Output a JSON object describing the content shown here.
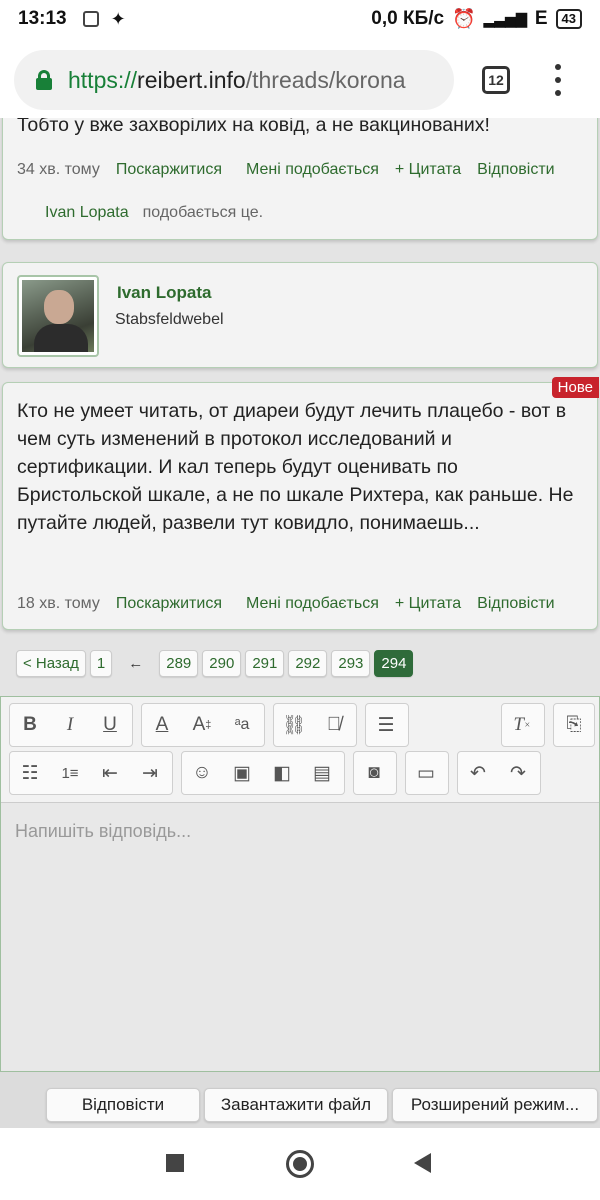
{
  "statusbar": {
    "time": "13:13",
    "net_speed": "0,0 КБ/с",
    "network_type": "E",
    "battery": "43"
  },
  "browser": {
    "url_scheme": "https://",
    "url_host": "reibert.info",
    "url_path": "/threads/korona",
    "tab_count": "12"
  },
  "post1": {
    "text": "Тобто у вже захворілих на ковід, а не вакцинованих!",
    "time_ago": "34 хв. тому",
    "report": "Поскаржитися",
    "like": "Мені подобається",
    "quote": "+ Цитата",
    "reply": "Відповісти",
    "liked_by": "Ivan Lopata",
    "likes_suffix": "подобається це."
  },
  "user": {
    "name": "Ivan Lopata",
    "rank": "Stabsfeldwebel"
  },
  "post2": {
    "badge": "Нове",
    "text": "Кто не умеет читать, от диареи будут лечить плацебо - вот в чем суть изменений в протокол исследований и сертификации. И кал теперь будут оценивать по Бристольской шкале, а не по шкале Рихтера, как раньше. Не путайте людей, развели тут ковидло, понимаешь...",
    "time_ago": "18 хв. тому",
    "report": "Поскаржитися",
    "like": "Мені подобається",
    "quote": "+ Цитата",
    "reply": "Відповісти"
  },
  "pagination": {
    "prev": "< Назад",
    "first": "1",
    "ellipsis": "←",
    "pages": [
      "289",
      "290",
      "291",
      "292",
      "293"
    ],
    "current": "294"
  },
  "editor": {
    "placeholder": "Напишіть відповідь...",
    "submit": "Відповісти",
    "upload": "Завантажити файл",
    "advanced": "Розширений режим..."
  },
  "colors": {
    "accent_green": "#2e6b2e",
    "current_page": "#2f6b3a",
    "new_badge": "#c8232c"
  }
}
